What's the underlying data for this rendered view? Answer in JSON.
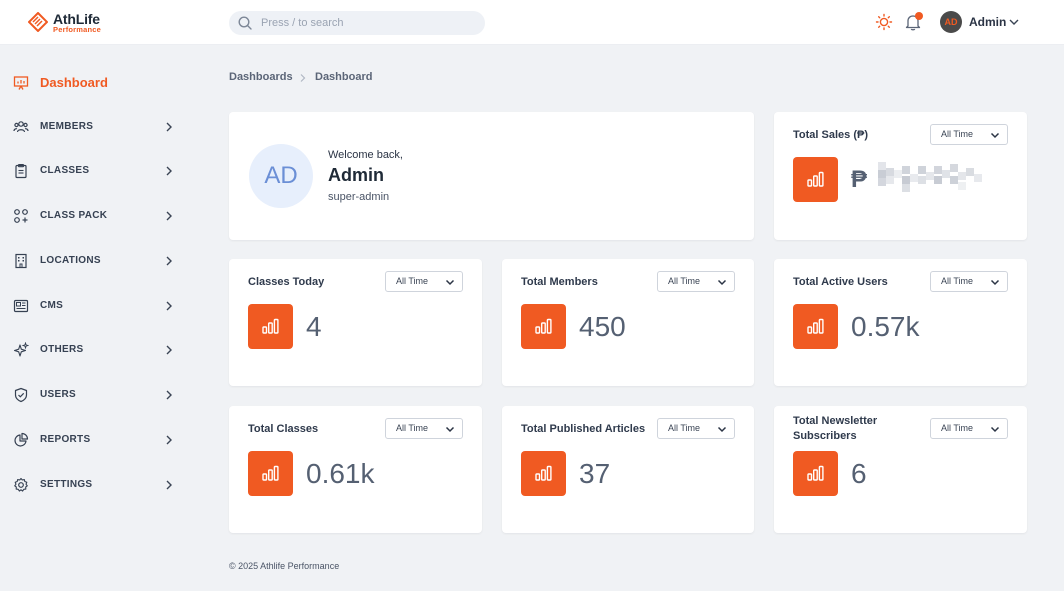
{
  "header": {
    "brand": "AthLife",
    "brand_sub": "Performance",
    "search_placeholder": "Press / to search",
    "user_initials": "AD",
    "user_name": "Admin"
  },
  "sidebar": {
    "items": [
      {
        "label": "Dashboard",
        "icon": "presentation-chart-icon",
        "active": true
      },
      {
        "label": "MEMBERS",
        "icon": "users-group-icon"
      },
      {
        "label": "CLASSES",
        "icon": "clipboard-icon"
      },
      {
        "label": "CLASS PACK",
        "icon": "squares-plus-icon"
      },
      {
        "label": "LOCATIONS",
        "icon": "building-icon"
      },
      {
        "label": "CMS",
        "icon": "newspaper-icon"
      },
      {
        "label": "OTHERS",
        "icon": "sparkles-icon"
      },
      {
        "label": "USERS",
        "icon": "shield-check-icon"
      },
      {
        "label": "REPORTS",
        "icon": "pie-chart-icon"
      },
      {
        "label": "SETTINGS",
        "icon": "gear-icon"
      }
    ]
  },
  "breadcrumb": {
    "root": "Dashboards",
    "current": "Dashboard"
  },
  "welcome": {
    "initials": "AD",
    "greeting": "Welcome back,",
    "name": "Admin",
    "role": "super-admin"
  },
  "stats": {
    "total_sales": {
      "title": "Total Sales (₱)",
      "filter": "All Time",
      "currency": "₱",
      "value_hidden": true
    },
    "classes_today": {
      "title": "Classes Today",
      "filter": "All Time",
      "value": "4"
    },
    "total_members": {
      "title": "Total Members",
      "filter": "All Time",
      "value": "450"
    },
    "total_active_users": {
      "title": "Total Active Users",
      "filter": "All Time",
      "value": "0.57k"
    },
    "total_classes": {
      "title": "Total Classes",
      "filter": "All Time",
      "value": "0.61k"
    },
    "total_published_articles": {
      "title": "Total Published Articles",
      "filter": "All Time",
      "value": "37"
    },
    "total_newsletter_subscribers": {
      "title": "Total Newsletter Subscribers",
      "filter": "All Time",
      "value": "6"
    }
  },
  "footer": {
    "text": "© 2025 Athlife Performance"
  },
  "colors": {
    "accent": "#f05a22",
    "background": "#f0f2f5",
    "card": "#ffffff"
  }
}
